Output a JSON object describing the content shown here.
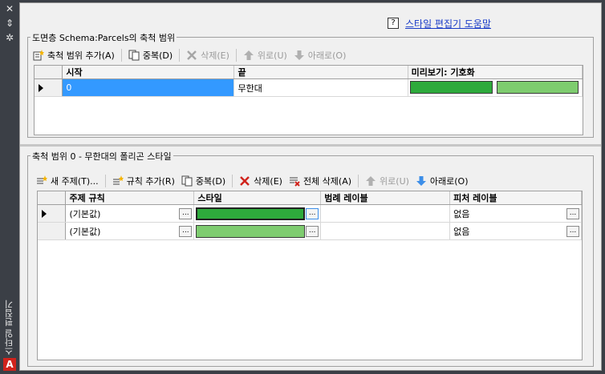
{
  "window": {
    "title": "스타일 편집기",
    "close_glyph": "✕",
    "pin_glyph": "⇕",
    "settings_glyph": "✲",
    "logo_letter": "A"
  },
  "help": {
    "icon_glyph": "?",
    "link": "스타일 편집기 도움말"
  },
  "ranges_group": {
    "title": "도면층 Schema:Parcels의 축척 범위",
    "toolbar": {
      "add": "축척 범위 추가(A)",
      "duplicate": "중복(D)",
      "delete": "삭제(E)",
      "up": "위로(U)",
      "down": "아래로(O)"
    },
    "columns": [
      "시작",
      "끝",
      "미리보기: 기호화"
    ],
    "rows": [
      {
        "start": "0",
        "end": "무한대",
        "preview_colors": [
          "#2eaa3c",
          "#7ecc6f"
        ]
      }
    ]
  },
  "styles_group": {
    "title": "축척 범위 0 - 무한대의 폴리곤 스타일",
    "toolbar": {
      "new_theme": "새 주제(T)...",
      "add_rule": "규칙 추가(R)",
      "duplicate": "중복(D)",
      "delete": "삭제(E)",
      "delete_all": "전체 삭제(A)",
      "up": "위로(U)",
      "down": "아래로(O)"
    },
    "columns": [
      "주제 규칙",
      "스타일",
      "범례 레이블",
      "피처 레이블"
    ],
    "ellipsis": "...",
    "rows": [
      {
        "rule": "(기본값)",
        "style_color": "#2eaa3c",
        "legend_label": "",
        "feature_label": "없음"
      },
      {
        "rule": "(기본값)",
        "style_color": "#7ecc6f",
        "legend_label": "",
        "feature_label": "없음"
      }
    ]
  },
  "colors": {
    "selection": "#3399ff",
    "link": "#1a3cc8",
    "sidebar": "#3b3f46",
    "delete_red": "#d0231c"
  }
}
